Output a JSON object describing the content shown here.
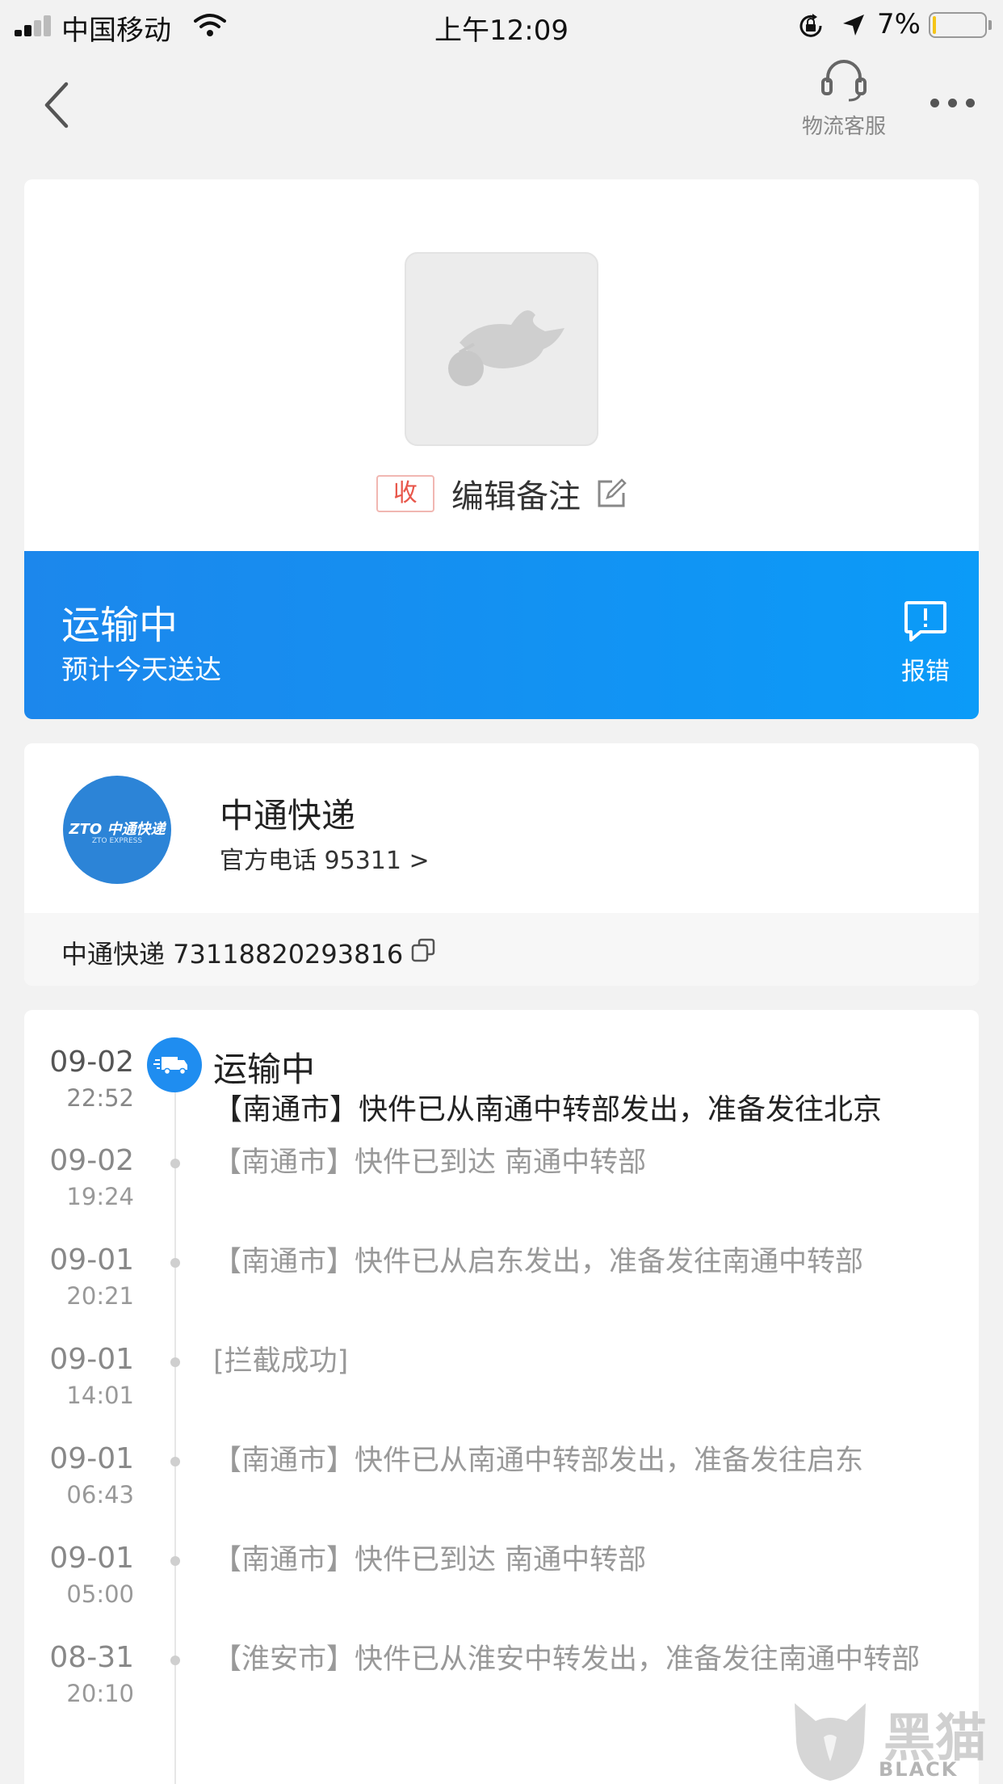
{
  "status_bar": {
    "carrier": "中国移动",
    "time": "上午12:09",
    "battery_percent": "7%",
    "battery_level": 0.07
  },
  "nav": {
    "support_label": "物流客服"
  },
  "package": {
    "tag": "收",
    "note_label": "编辑备注"
  },
  "status": {
    "title": "运输中",
    "subtitle": "预计今天送达",
    "report_label": "报错",
    "gradient_start": "#1c87ec",
    "gradient_end": "#0b9bf8"
  },
  "carrier": {
    "logo_text": "ZTO 中通快递",
    "logo_sub": "ZTO EXPRESS",
    "name": "中通快递",
    "phone_link": "官方电话 95311 >",
    "tracking": "中通快递 73118820293816",
    "brand_color": "#2c84d7"
  },
  "timeline": {
    "current": {
      "date": "09-02",
      "time": "22:52",
      "title": "运输中",
      "desc": "【南通市】快件已从南通中转部发出，准备发往北京"
    },
    "events": [
      {
        "date": "09-02",
        "time": "19:24",
        "desc": "【南通市】快件已到达 南通中转部"
      },
      {
        "date": "09-01",
        "time": "20:21",
        "desc": "【南通市】快件已从启东发出，准备发往南通中转部"
      },
      {
        "date": "09-01",
        "time": "14:01",
        "desc": "[拦截成功]"
      },
      {
        "date": "09-01",
        "time": "06:43",
        "desc": "【南通市】快件已从南通中转部发出，准备发往启东"
      },
      {
        "date": "09-01",
        "time": "05:00",
        "desc": "【南通市】快件已到达 南通中转部"
      },
      {
        "date": "08-31",
        "time": "20:10",
        "desc": "【淮安市】快件已从淮安中转发出，准备发往南通中转部"
      }
    ]
  },
  "watermark": {
    "text": "黑猫",
    "sub": "BLACK CAT"
  }
}
